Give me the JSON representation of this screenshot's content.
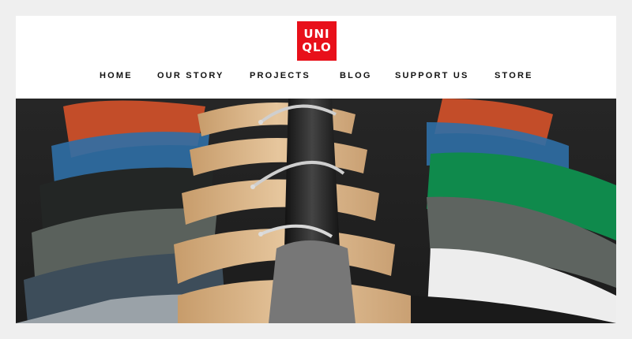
{
  "brand": {
    "logo_line1": "UNI",
    "logo_line2": "QLO",
    "logo_color": "#e8101a"
  },
  "nav": {
    "items": [
      {
        "label": "HOME"
      },
      {
        "label": "OUR STORY"
      },
      {
        "label": "PROJECTS"
      },
      {
        "label": "BLOG"
      },
      {
        "label": "SUPPORT US"
      },
      {
        "label": "STORE"
      }
    ]
  },
  "hero": {
    "subject": "shirts-on-wooden-hangers-photo",
    "colors": {
      "rail": "#2a2a2a",
      "hanger": "#d9b88c",
      "shirt_orange": "#d5522a",
      "shirt_blue": "#2f6fa6",
      "shirt_green": "#0f8a4c",
      "shirt_dark": "#2f3230",
      "shirt_gray": "#6e7470"
    }
  }
}
